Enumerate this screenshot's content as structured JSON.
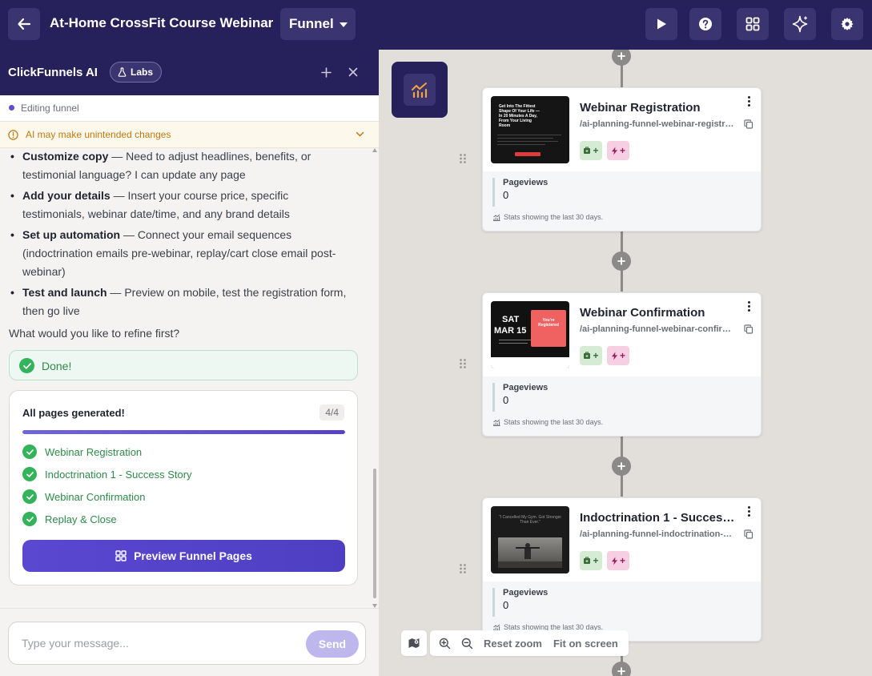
{
  "topbar": {
    "title": "At-Home CrossFit Course Webinar",
    "funnel_dropdown": "Funnel",
    "icons": [
      "back-arrow-icon",
      "play-icon",
      "help-icon",
      "apps-grid-icon",
      "ai-sparkle-icon",
      "settings-gear-icon"
    ]
  },
  "ai_panel": {
    "title": "ClickFunnels AI",
    "labs_label": "Labs",
    "editing_status": "Editing funnel",
    "warning": "AI may make unintended changes",
    "bullets": [
      {
        "bold": "Customize copy",
        "text": " — Need to adjust headlines, benefits, or testimonial language? I can update any page"
      },
      {
        "bold": "Add your details",
        "text": " — Insert your course price, specific testimonials, webinar date/time, and any brand details"
      },
      {
        "bold": "Set up automation",
        "text": " — Connect your email sequences (indoctrination emails pre-webinar, replay/cart close email post-webinar)"
      },
      {
        "bold": "Test and launch",
        "text": " — Preview on mobile, test the registration form, then go live"
      }
    ],
    "question": "What would you like to refine first?",
    "done_label": "Done!",
    "pages_card": {
      "title": "All pages generated!",
      "count": "4/4",
      "progress": 1.0,
      "items": [
        "Webinar Registration",
        "Indoctrination 1 - Success Story",
        "Webinar Confirmation",
        "Replay & Close"
      ],
      "preview_button": "Preview Funnel Pages"
    },
    "composer": {
      "placeholder": "Type your message...",
      "send_label": "Send"
    }
  },
  "canvas": {
    "steps": [
      {
        "name": "Webinar Registration",
        "path": "/ai-planning-funnel-webinar-registration",
        "pageviews_label": "Pageviews",
        "pageviews": "0",
        "stats_note": "Stats showing the last 30 days.",
        "thumb_text": "Get Into The Fittest Shape Of Your Life — In 20 Minutes A Day, From Your Living Room"
      },
      {
        "name": "Webinar Confirmation",
        "path": "/ai-planning-funnel-webinar-confirmation",
        "pageviews_label": "Pageviews",
        "pageviews": "0",
        "stats_note": "Stats showing the last 30 days.",
        "thumb_day": "SAT",
        "thumb_date": "MAR 15",
        "thumb_badge": "You're Registered"
      },
      {
        "name": "Indoctrination 1 - Success Story",
        "path": "/ai-planning-funnel-indoctrination-1-success-story",
        "pageviews_label": "Pageviews",
        "pageviews": "0",
        "stats_note": "Stats showing the last 30 days.",
        "thumb_text": "\"I Cancelled My Gym. Got Stronger Than Ever.\""
      }
    ],
    "zoom_controls": {
      "reset": "Reset zoom",
      "fit": "Fit on screen"
    }
  },
  "colors": {
    "navy": "#26215a",
    "accent_purple": "#5a48d0",
    "success_green": "#34b35a",
    "warning_orange": "#c2780f"
  }
}
